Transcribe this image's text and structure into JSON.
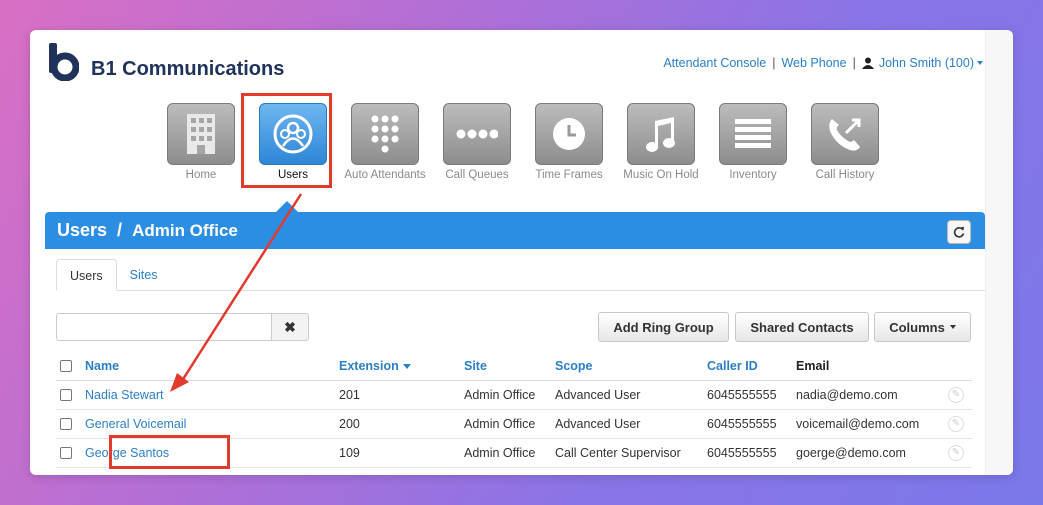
{
  "header": {
    "brand": "B1 Communications",
    "links": [
      "Attendant Console",
      "Web Phone"
    ],
    "user": "John Smith (100)"
  },
  "nav": [
    {
      "label": "Home",
      "icon": "building-icon",
      "active": false
    },
    {
      "label": "Users",
      "icon": "users-icon",
      "active": true
    },
    {
      "label": "Auto Attendants",
      "icon": "keypad-icon",
      "active": false
    },
    {
      "label": "Call Queues",
      "icon": "queue-dots-icon",
      "active": false
    },
    {
      "label": "Time Frames",
      "icon": "clock-icon",
      "active": false
    },
    {
      "label": "Music On Hold",
      "icon": "music-note-icon",
      "active": false
    },
    {
      "label": "Inventory",
      "icon": "list-icon",
      "active": false
    },
    {
      "label": "Call History",
      "icon": "phone-history-icon",
      "active": false
    }
  ],
  "title_bar": {
    "section": "Users",
    "subsection": "Admin Office"
  },
  "tabs": [
    "Users",
    "Sites"
  ],
  "toolbar": {
    "search_value": "",
    "clear_label": "✖",
    "add_ring_group": "Add Ring Group",
    "shared_contacts": "Shared Contacts",
    "columns": "Columns"
  },
  "table": {
    "headers": [
      "Name",
      "Extension",
      "Site",
      "Scope",
      "Caller ID",
      "Email"
    ],
    "rows": [
      {
        "name": "Nadia Stewart",
        "extension": "201",
        "site": "Admin Office",
        "scope": "Advanced User",
        "caller_id": "6045555555",
        "email": "nadia@demo.com"
      },
      {
        "name": "General Voicemail",
        "extension": "200",
        "site": "Admin Office",
        "scope": "Advanced User",
        "caller_id": "6045555555",
        "email": "voicemail@demo.com"
      },
      {
        "name": "George Santos",
        "extension": "109",
        "site": "Admin Office",
        "scope": "Call Center Supervisor",
        "caller_id": "6045555555",
        "email": "goerge@demo.com"
      }
    ]
  },
  "colors": {
    "accent": "#2b8ee3",
    "link": "#2b7fc6",
    "annotation": "#e23a2c",
    "brand": "#20335b"
  }
}
